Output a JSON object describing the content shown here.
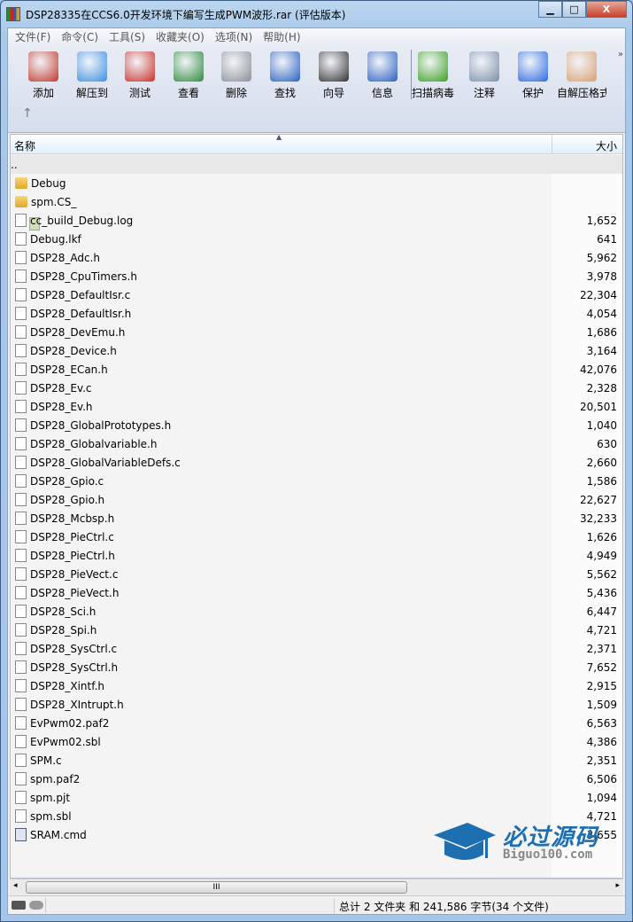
{
  "window": {
    "title": "DSP28335在CCS6.0开发环境下编写生成PWM波形.rar (评估版本)",
    "minimize": "▁",
    "maximize": "□",
    "close": "X"
  },
  "menu": [
    "文件(F)",
    "命令(C)",
    "工具(S)",
    "收藏夹(O)",
    "选项(N)",
    "帮助(H)"
  ],
  "toolbar": [
    {
      "label": "添加",
      "icon": "add-archive-icon",
      "color": "#c0392b"
    },
    {
      "label": "解压到",
      "icon": "extract-folder-icon",
      "color": "#3d8ee0"
    },
    {
      "label": "测试",
      "icon": "test-clipboard-icon",
      "color": "#c8302a"
    },
    {
      "label": "查看",
      "icon": "view-book-icon",
      "color": "#2f8a3a"
    },
    {
      "label": "删除",
      "icon": "delete-trash-icon",
      "color": "#8a9098"
    },
    {
      "label": "查找",
      "icon": "find-magnifier-icon",
      "color": "#2a5fc0"
    },
    {
      "label": "向导",
      "icon": "wizard-wand-icon",
      "color": "#333333"
    },
    {
      "label": "信息",
      "icon": "info-icon",
      "color": "#2a5fc0"
    },
    {
      "label": "扫描病毒",
      "icon": "virus-scan-icon",
      "color": "#3aa020"
    },
    {
      "label": "注释",
      "icon": "comment-icon",
      "color": "#7a8ea8"
    },
    {
      "label": "保护",
      "icon": "protect-shield-icon",
      "color": "#2a6ae0"
    },
    {
      "label": "自解压格式",
      "icon": "sfx-box-icon",
      "color": "#d8a070"
    }
  ],
  "toolbar_more": "»",
  "up_arrow": "↑",
  "columns": {
    "name": "名称",
    "size": "大小",
    "sort_indicator": "▲"
  },
  "files": [
    {
      "name": "..",
      "size": "",
      "type": "up"
    },
    {
      "name": "Debug",
      "size": "",
      "type": "folder"
    },
    {
      "name": "spm.CS_",
      "size": "",
      "type": "folder"
    },
    {
      "name": "cc_build_Debug.log",
      "size": "1,652",
      "type": "file"
    },
    {
      "name": "Debug.lkf",
      "size": "641",
      "type": "file"
    },
    {
      "name": "DSP28_Adc.h",
      "size": "5,962",
      "type": "file"
    },
    {
      "name": "DSP28_CpuTimers.h",
      "size": "3,978",
      "type": "file"
    },
    {
      "name": "DSP28_DefaultIsr.c",
      "size": "22,304",
      "type": "file"
    },
    {
      "name": "DSP28_DefaultIsr.h",
      "size": "4,054",
      "type": "file"
    },
    {
      "name": "DSP28_DevEmu.h",
      "size": "1,686",
      "type": "file"
    },
    {
      "name": "DSP28_Device.h",
      "size": "3,164",
      "type": "file"
    },
    {
      "name": "DSP28_ECan.h",
      "size": "42,076",
      "type": "file"
    },
    {
      "name": "DSP28_Ev.c",
      "size": "2,328",
      "type": "file"
    },
    {
      "name": "DSP28_Ev.h",
      "size": "20,501",
      "type": "file"
    },
    {
      "name": "DSP28_GlobalPrototypes.h",
      "size": "1,040",
      "type": "file"
    },
    {
      "name": "DSP28_Globalvariable.h",
      "size": "630",
      "type": "file"
    },
    {
      "name": "DSP28_GlobalVariableDefs.c",
      "size": "2,660",
      "type": "file"
    },
    {
      "name": "DSP28_Gpio.c",
      "size": "1,586",
      "type": "file"
    },
    {
      "name": "DSP28_Gpio.h",
      "size": "22,627",
      "type": "file"
    },
    {
      "name": "DSP28_Mcbsp.h",
      "size": "32,233",
      "type": "file"
    },
    {
      "name": "DSP28_PieCtrl.c",
      "size": "1,626",
      "type": "file"
    },
    {
      "name": "DSP28_PieCtrl.h",
      "size": "4,949",
      "type": "file"
    },
    {
      "name": "DSP28_PieVect.c",
      "size": "5,562",
      "type": "file"
    },
    {
      "name": "DSP28_PieVect.h",
      "size": "5,436",
      "type": "file"
    },
    {
      "name": "DSP28_Sci.h",
      "size": "6,447",
      "type": "file"
    },
    {
      "name": "DSP28_Spi.h",
      "size": "4,721",
      "type": "file"
    },
    {
      "name": "DSP28_SysCtrl.c",
      "size": "2,371",
      "type": "file"
    },
    {
      "name": "DSP28_SysCtrl.h",
      "size": "7,652",
      "type": "file"
    },
    {
      "name": "DSP28_Xintf.h",
      "size": "2,915",
      "type": "file"
    },
    {
      "name": "DSP28_XIntrupt.h",
      "size": "1,509",
      "type": "file"
    },
    {
      "name": "EvPwm02.paf2",
      "size": "6,563",
      "type": "file"
    },
    {
      "name": "EvPwm02.sbl",
      "size": "4,386",
      "type": "file"
    },
    {
      "name": "SPM.c",
      "size": "2,351",
      "type": "file"
    },
    {
      "name": "spm.paf2",
      "size": "6,506",
      "type": "file"
    },
    {
      "name": "spm.pjt",
      "size": "1,094",
      "type": "file"
    },
    {
      "name": "spm.sbl",
      "size": "4,721",
      "type": "file"
    },
    {
      "name": "SRAM.cmd",
      "size": "3,655",
      "type": "cmd"
    }
  ],
  "scrollbar": {
    "left": "◂",
    "right": "▸",
    "grip": "III"
  },
  "status": {
    "summary": "总计 2 文件夹 和 241,586 字节(34 个文件)"
  },
  "watermark": {
    "cn": "必过源码",
    "en": "Biguo100.com"
  }
}
